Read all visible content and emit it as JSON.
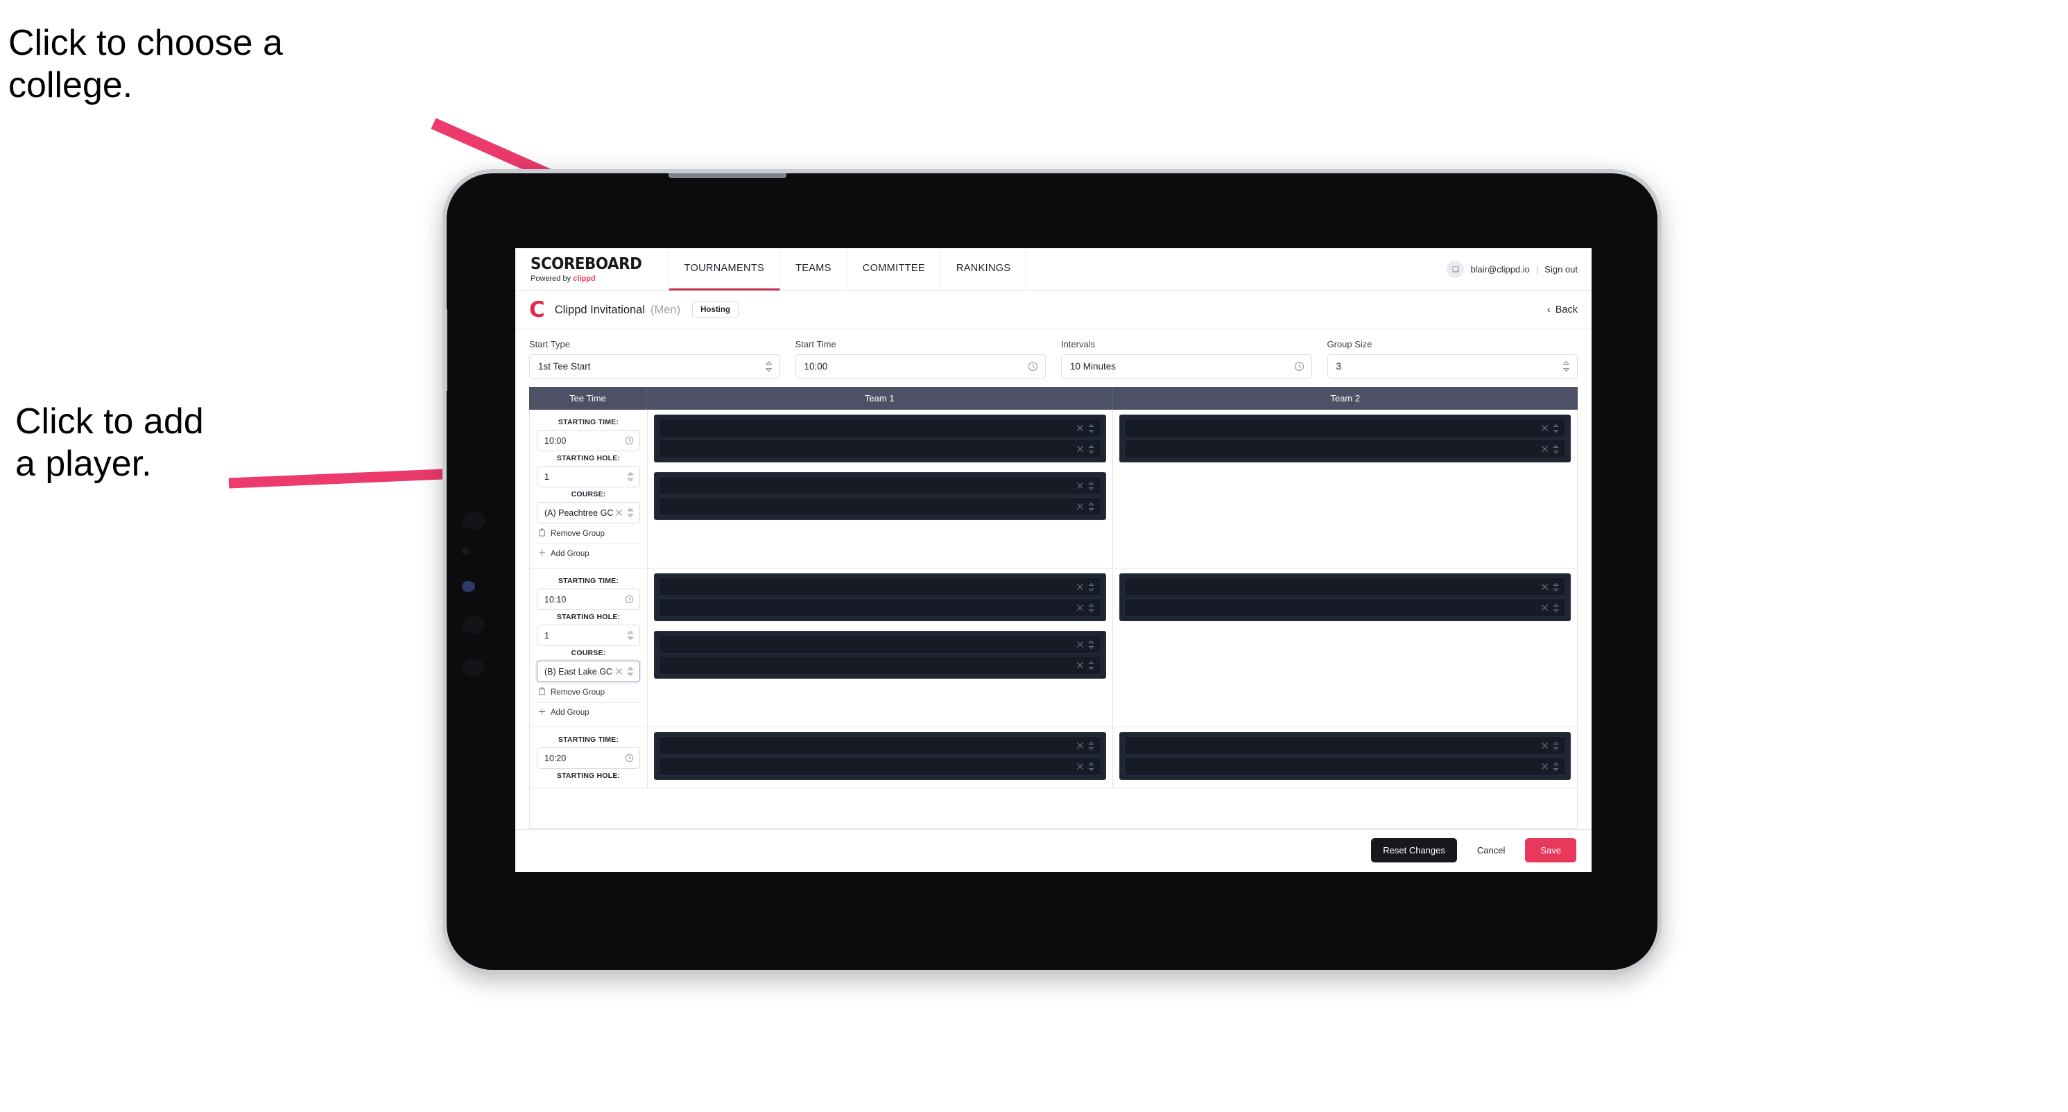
{
  "annotations": {
    "choose_college": "Click to choose a\ncollege.",
    "add_player": "Click to add\na player.",
    "arrow_color": "#eb3a6b"
  },
  "nav": {
    "brand_title": "SCOREBOARD",
    "brand_sub_prefix": "Powered by ",
    "brand_sub_name": "clippd",
    "items": [
      {
        "label": "TOURNAMENTS",
        "active": true
      },
      {
        "label": "TEAMS",
        "active": false
      },
      {
        "label": "COMMITTEE",
        "active": false
      },
      {
        "label": "RANKINGS",
        "active": false
      }
    ],
    "user_email": "blair@clippd.io",
    "user_separator": "|",
    "sign_out": "Sign out",
    "avatar_glyph": "❑"
  },
  "subheader": {
    "logo_letter": "C",
    "tournament_name": "Clippd Invitational",
    "gender": "(Men)",
    "badge": "Hosting",
    "back_label": "Back",
    "back_chevron": "‹"
  },
  "form": {
    "fields": [
      {
        "label": "Start Type",
        "value": "1st Tee Start",
        "icon": "stepper-icon"
      },
      {
        "label": "Start Time",
        "value": "10:00",
        "icon": "clock-icon"
      },
      {
        "label": "Intervals",
        "value": "10 Minutes",
        "icon": "clock-icon"
      },
      {
        "label": "Group Size",
        "value": "3",
        "icon": "stepper-icon"
      }
    ]
  },
  "table": {
    "headers": [
      "Tee Time",
      "Team 1",
      "Team 2"
    ],
    "labels": {
      "starting_time": "STARTING TIME:",
      "starting_hole": "STARTING HOLE:",
      "course": "COURSE:",
      "remove_group": "Remove Group",
      "add_group": "Add Group"
    },
    "groups": [
      {
        "starting_time": "10:00",
        "starting_hole": "1",
        "course": "(A) Peachtree GC",
        "course_focused": false,
        "team1_panels": [
          {
            "slots": [
              "",
              ""
            ]
          },
          {
            "slots": [
              "",
              ""
            ]
          }
        ],
        "team2_panels": [
          {
            "slots": [
              "",
              ""
            ]
          }
        ]
      },
      {
        "starting_time": "10:10",
        "starting_hole": "1",
        "course": "(B) East Lake GC",
        "course_focused": true,
        "team1_panels": [
          {
            "slots": [
              "",
              ""
            ]
          },
          {
            "slots": [
              "",
              ""
            ]
          }
        ],
        "team2_panels": [
          {
            "slots": [
              "",
              ""
            ]
          }
        ]
      },
      {
        "starting_time": "10:20",
        "starting_hole": "",
        "course": "",
        "course_focused": false,
        "clipped": true,
        "team1_panels": [
          {
            "slots": [
              "",
              ""
            ]
          }
        ],
        "team2_panels": [
          {
            "slots": [
              "",
              ""
            ]
          }
        ]
      }
    ]
  },
  "footer": {
    "reset_label": "Reset Changes",
    "cancel_label": "Cancel",
    "save_label": "Save",
    "save_color": "#e8385c"
  }
}
